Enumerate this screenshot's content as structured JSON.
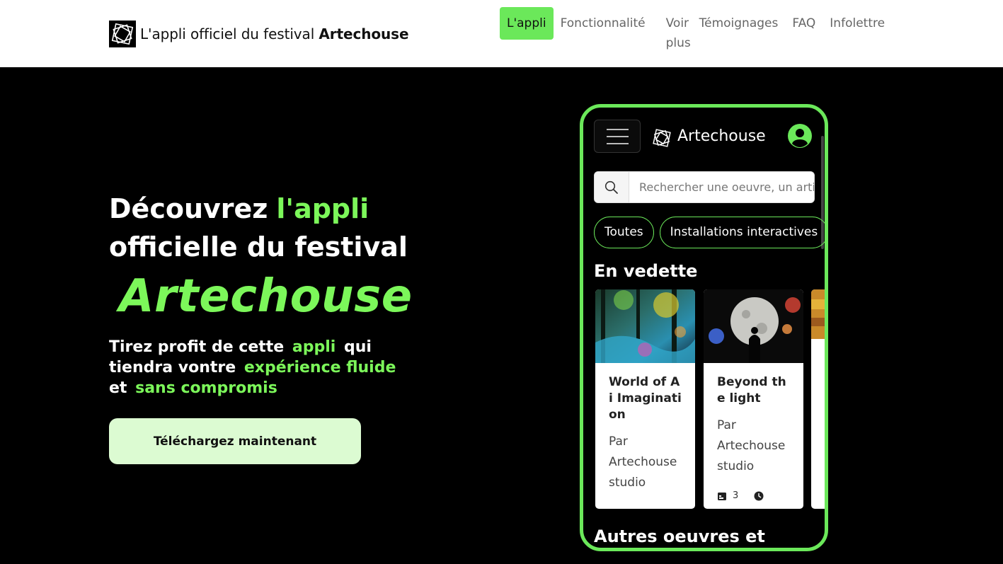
{
  "header": {
    "brand_prefix": "L'appli officiel du festival",
    "brand_name": "Artechouse",
    "nav": [
      {
        "label": "L'appli",
        "active": true
      },
      {
        "label": "Fonctionnalité"
      },
      {
        "label": "Voir plus"
      },
      {
        "label": "Témoignages"
      },
      {
        "label": "FAQ"
      },
      {
        "label": "Infolettre"
      }
    ]
  },
  "hero": {
    "title_part1": "Découvrez",
    "title_highlight": "l'appli",
    "title_part2": "officielle du festival",
    "title_big": "Artechouse",
    "sub_part1": "Tirez profit de cette",
    "sub_highlight1": "appli",
    "sub_part2": "qui tiendra vontre",
    "sub_highlight2": "expérience fluide",
    "sub_part3": "et",
    "sub_highlight3": "sans compromis",
    "cta_label": "Téléchargez maintenant"
  },
  "phone": {
    "app_title": "Artechouse",
    "search_placeholder": "Rechercher une oeuvre, un artiste",
    "chips": [
      "Toutes",
      "Installations interactives"
    ],
    "featured_title": "En vedette",
    "other_title": "Autres oeuvres et",
    "cards": [
      {
        "title": "World of Ai Imagination",
        "author": "Par Artechouse studio"
      },
      {
        "title": "Beyond the light",
        "author": "Par Artechouse studio",
        "count": "3"
      }
    ]
  },
  "colors": {
    "accent": "#7cf75a",
    "nav_active": "#6be85a",
    "cta_bg": "#dcfbd2"
  }
}
